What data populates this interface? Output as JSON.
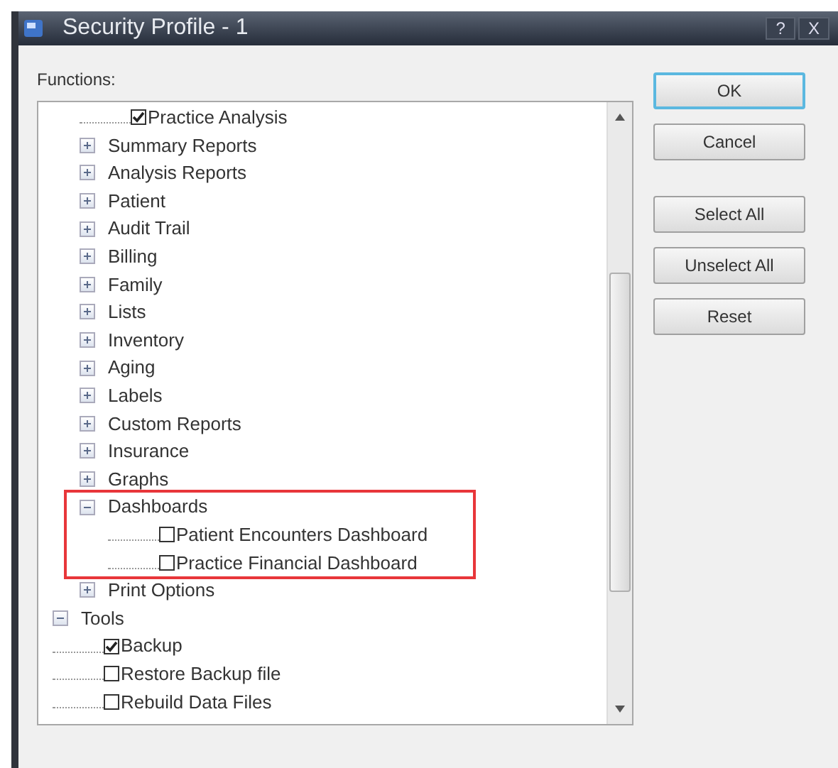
{
  "window": {
    "title": "Security Profile - 1",
    "title_buttons": [
      "?",
      "X"
    ]
  },
  "functions_label": "Functions:",
  "tree": [
    {
      "children": [
        {
          "children": [
            {
              "kind": "checkbox",
              "label": "Practice Analysis",
              "checked": true
            }
          ]
        },
        {
          "kind": "node",
          "label": "Summary Reports",
          "expanded": false
        },
        {
          "kind": "node",
          "label": "Analysis Reports",
          "expanded": false
        },
        {
          "kind": "node",
          "label": "Patient",
          "expanded": false
        },
        {
          "kind": "node",
          "label": "Audit Trail",
          "expanded": false
        },
        {
          "kind": "node",
          "label": "Billing",
          "expanded": false
        },
        {
          "kind": "node",
          "label": "Family",
          "expanded": false
        },
        {
          "kind": "node",
          "label": "Lists",
          "expanded": false
        },
        {
          "kind": "node",
          "label": "Inventory",
          "expanded": false
        },
        {
          "kind": "node",
          "label": "Aging",
          "expanded": false
        },
        {
          "kind": "node",
          "label": "Labels",
          "expanded": false
        },
        {
          "kind": "node",
          "label": "Custom Reports",
          "expanded": false
        },
        {
          "kind": "node",
          "label": "Insurance",
          "expanded": false
        },
        {
          "kind": "node",
          "label": "Graphs",
          "expanded": false
        },
        {
          "kind": "node",
          "label": "Dashboards",
          "expanded": true,
          "highlighted": true,
          "children": [
            {
              "kind": "checkbox",
              "label": "Patient Encounters Dashboard",
              "checked": false
            },
            {
              "kind": "checkbox",
              "label": "Practice Financial Dashboard",
              "checked": false
            }
          ]
        },
        {
          "kind": "node",
          "label": "Print Options",
          "expanded": false
        }
      ]
    },
    {
      "kind": "node",
      "label": "Tools",
      "expanded": true,
      "children": [
        {
          "kind": "checkbox",
          "label": "Backup",
          "checked": true
        },
        {
          "kind": "checkbox",
          "label": "Restore Backup file",
          "checked": false
        },
        {
          "kind": "checkbox",
          "label": "Rebuild Data Files",
          "checked": false
        }
      ]
    }
  ],
  "buttons": [
    {
      "label": "OK",
      "default": true
    },
    {
      "label": "Cancel",
      "default": false
    },
    {
      "label": "Select All",
      "default": false
    },
    {
      "label": "Unselect All",
      "default": false
    },
    {
      "label": "Reset",
      "default": false
    }
  ]
}
